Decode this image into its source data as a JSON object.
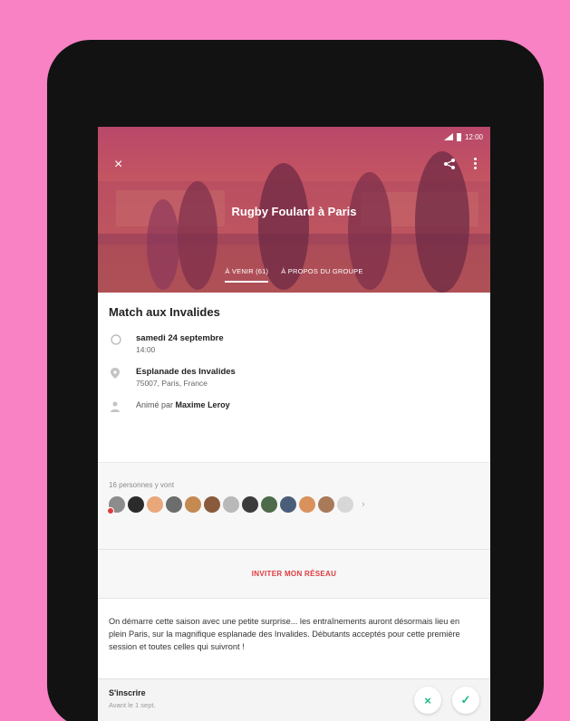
{
  "status_bar": {
    "time": "12:00"
  },
  "header": {
    "group_name": "Rugby Foulard à Paris",
    "tabs": [
      {
        "label": "À VENIR (61)",
        "active": true
      },
      {
        "label": "À PROPOS DU GROUPE",
        "active": false
      }
    ]
  },
  "event": {
    "title": "Match aux Invalides",
    "date": "samedi 24 septembre",
    "time": "14:00",
    "venue": "Esplanade des Invalides",
    "address": "75007, Paris, France",
    "host_prefix": "Animé par",
    "host_name": "Maxime Leroy"
  },
  "attendees": {
    "count_label": "16 personnes y vont",
    "avatar_colors": [
      "#8c8c8c",
      "#2b2b2b",
      "#e9a77a",
      "#6d6d6d",
      "#c58a52",
      "#8a5a3c",
      "#b9b9b9",
      "#3c3c3c",
      "#4d6b4a",
      "#4a5e7a",
      "#d9925c",
      "#a87a5a",
      "#d7d7d7"
    ]
  },
  "invite_label": "INVITER MON RÉSEAU",
  "description": "On démarre cette saison avec une petite surprise... les entraînements auront désormais lieu en plein Paris, sur la magnifique esplanade des Invalides. Débutants acceptés pour cette première session et toutes celles qui suivront !",
  "footer": {
    "title": "S'inscrire",
    "subtitle": "Avant le 1 sept.",
    "decline_icon": "×",
    "accept_icon": "✓"
  },
  "colors": {
    "accent": "#e0393e",
    "rsvp": "#1fb98a",
    "background": "#f882c4"
  }
}
